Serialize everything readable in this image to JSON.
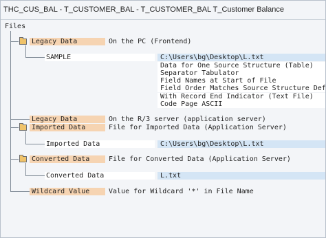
{
  "window": {
    "title": "THC_CUS_BAL - T_CUSTOMER_BAL - T_CUSTOMER_BAL T_Customer Balance"
  },
  "tree": {
    "root": "Files",
    "legacy_pc": {
      "label": "Legacy Data",
      "desc": "On the PC (Frontend)"
    },
    "sample": {
      "label": "SAMPLE",
      "path": "C:\\Users\\bg\\Desktop\\L.txt",
      "props": [
        "Data for One Source Structure (Table)",
        "Separator Tabulator",
        "Field Names at Start of File",
        "Field Order Matches Source Structure Definiti",
        "With Record End Indicator (Text File)",
        "Code Page ASCII"
      ]
    },
    "legacy_r3": {
      "label": "Legacy Data",
      "desc": "On the R/3 server (application server)"
    },
    "imported": {
      "label": "Imported Data",
      "desc": "File for Imported Data (Application Server)",
      "child_label": "Imported Data",
      "child_value": "C:\\Users\\bg\\Desktop\\L.txt"
    },
    "converted": {
      "label": "Converted Data",
      "desc": "File for Converted Data (Application Server)",
      "child_label": "Converted Data",
      "child_value": "L.txt"
    },
    "wildcard": {
      "label": "Wildcard Value",
      "desc": "Value for Wildcard '*' in File Name"
    }
  },
  "colors": {
    "node_label_bg": "#f6d4b2",
    "value_bg": "#d4e5f5",
    "background": "#f3f5f8"
  },
  "icons": [
    "folder-icon"
  ]
}
